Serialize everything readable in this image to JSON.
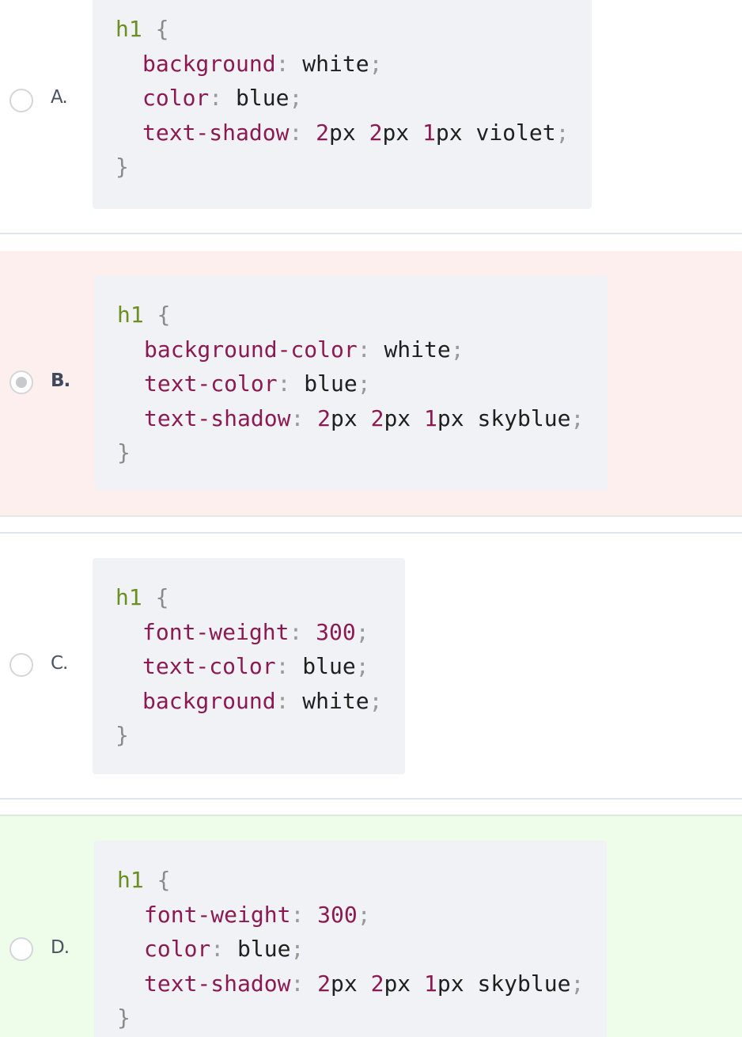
{
  "options": [
    {
      "letter": "A.",
      "selected": false,
      "state": "neutral",
      "code": {
        "selector": "h1",
        "open": "{",
        "close": "}",
        "decls": [
          {
            "prop": "background",
            "parts": [
              {
                "t": "val",
                "v": "white"
              }
            ]
          },
          {
            "prop": "color",
            "parts": [
              {
                "t": "val",
                "v": "blue"
              }
            ]
          },
          {
            "prop": "text-shadow",
            "parts": [
              {
                "t": "num",
                "v": "2"
              },
              {
                "t": "val",
                "v": "px "
              },
              {
                "t": "num",
                "v": "2"
              },
              {
                "t": "val",
                "v": "px "
              },
              {
                "t": "num",
                "v": "1"
              },
              {
                "t": "val",
                "v": "px violet"
              }
            ]
          }
        ]
      }
    },
    {
      "letter": "B.",
      "selected": true,
      "state": "wrong",
      "code": {
        "selector": "h1",
        "open": "{",
        "close": "}",
        "decls": [
          {
            "prop": "background-color",
            "parts": [
              {
                "t": "val",
                "v": "white"
              }
            ]
          },
          {
            "prop": "text-color",
            "parts": [
              {
                "t": "val",
                "v": "blue"
              }
            ]
          },
          {
            "prop": "text-shadow",
            "parts": [
              {
                "t": "num",
                "v": "2"
              },
              {
                "t": "val",
                "v": "px "
              },
              {
                "t": "num",
                "v": "2"
              },
              {
                "t": "val",
                "v": "px "
              },
              {
                "t": "num",
                "v": "1"
              },
              {
                "t": "val",
                "v": "px skyblue"
              }
            ]
          }
        ]
      }
    },
    {
      "letter": "C.",
      "selected": false,
      "state": "neutral",
      "code": {
        "selector": "h1",
        "open": "{",
        "close": "}",
        "decls": [
          {
            "prop": "font-weight",
            "parts": [
              {
                "t": "num",
                "v": "300"
              }
            ]
          },
          {
            "prop": "text-color",
            "parts": [
              {
                "t": "val",
                "v": "blue"
              }
            ]
          },
          {
            "prop": "background",
            "parts": [
              {
                "t": "val",
                "v": "white"
              }
            ]
          }
        ]
      }
    },
    {
      "letter": "D.",
      "selected": false,
      "state": "correct",
      "code": {
        "selector": "h1",
        "open": "{",
        "close": "}",
        "decls": [
          {
            "prop": "font-weight",
            "parts": [
              {
                "t": "num",
                "v": "300"
              }
            ]
          },
          {
            "prop": "color",
            "parts": [
              {
                "t": "val",
                "v": "blue"
              }
            ]
          },
          {
            "prop": "text-shadow",
            "parts": [
              {
                "t": "num",
                "v": "2"
              },
              {
                "t": "val",
                "v": "px "
              },
              {
                "t": "num",
                "v": "2"
              },
              {
                "t": "val",
                "v": "px "
              },
              {
                "t": "num",
                "v": "1"
              },
              {
                "t": "val",
                "v": "px skyblue"
              }
            ]
          }
        ]
      }
    }
  ],
  "colors": {
    "wrong_bg": "#fcefed",
    "correct_bg": "#eefcea",
    "code_bg": "#f1f2f5",
    "selector": "#6b8f21",
    "property": "#8c1a52",
    "number": "#8c1a52"
  }
}
